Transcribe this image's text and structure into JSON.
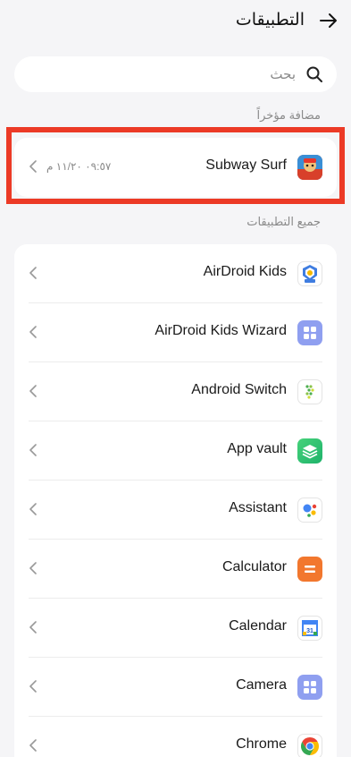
{
  "header": {
    "title": "التطبيقات"
  },
  "search": {
    "placeholder": "بحث"
  },
  "recent": {
    "label": "مضافة مؤخراً",
    "item": {
      "name": "Subway Surf",
      "time": "٠٩:٥٧ ١١/٢٠ م"
    }
  },
  "all_apps": {
    "label": "جميع التطبيقات",
    "items": [
      {
        "name": "AirDroid Kids",
        "icon": "airdroid-kids-icon"
      },
      {
        "name": "AirDroid Kids Wizard",
        "icon": "wizard-icon"
      },
      {
        "name": "Android Switch",
        "icon": "android-switch-icon"
      },
      {
        "name": "App vault",
        "icon": "app-vault-icon"
      },
      {
        "name": "Assistant",
        "icon": "assistant-icon"
      },
      {
        "name": "Calculator",
        "icon": "calculator-icon"
      },
      {
        "name": "Calendar",
        "icon": "calendar-icon"
      },
      {
        "name": "Camera",
        "icon": "camera-icon"
      },
      {
        "name": "Chrome",
        "icon": "chrome-icon"
      }
    ]
  },
  "colors": {
    "highlight": "#ec3a26",
    "background": "#f5f5f7"
  }
}
